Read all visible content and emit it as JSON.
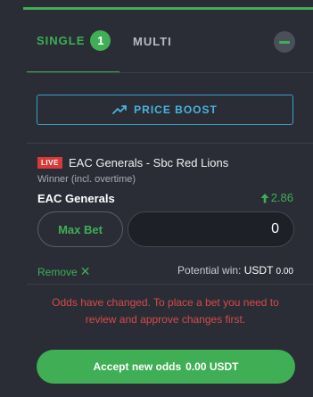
{
  "tabs": {
    "single_label": "SINGLE",
    "single_count": "1",
    "multi_label": "MULTI"
  },
  "price_boost": {
    "label": "PRICE BOOST",
    "icon": "trending-up-icon"
  },
  "bet": {
    "live_badge": "LIVE",
    "match": "EAC Generals - Sbc Red Lions",
    "market": "Winner (incl. overtime)",
    "selection": "EAC Generals",
    "odds": "2.86",
    "odds_direction": "up"
  },
  "stake": {
    "max_bet_label": "Max Bet",
    "value": "0"
  },
  "actions": {
    "remove_label": "Remove",
    "potential_win_label": "Potential win:",
    "potential_win_currency": "USDT",
    "potential_win_value": "0.00"
  },
  "warning": "Odds have changed. To place a bet you need to review and approve changes first.",
  "accept": {
    "label": "Accept new odds",
    "amount": "0.00 USDT"
  },
  "colors": {
    "accent": "#3fae55",
    "boost": "#48b4dd",
    "live": "#d83a3a",
    "warning": "#d64a4a",
    "background": "#2a2d36"
  }
}
